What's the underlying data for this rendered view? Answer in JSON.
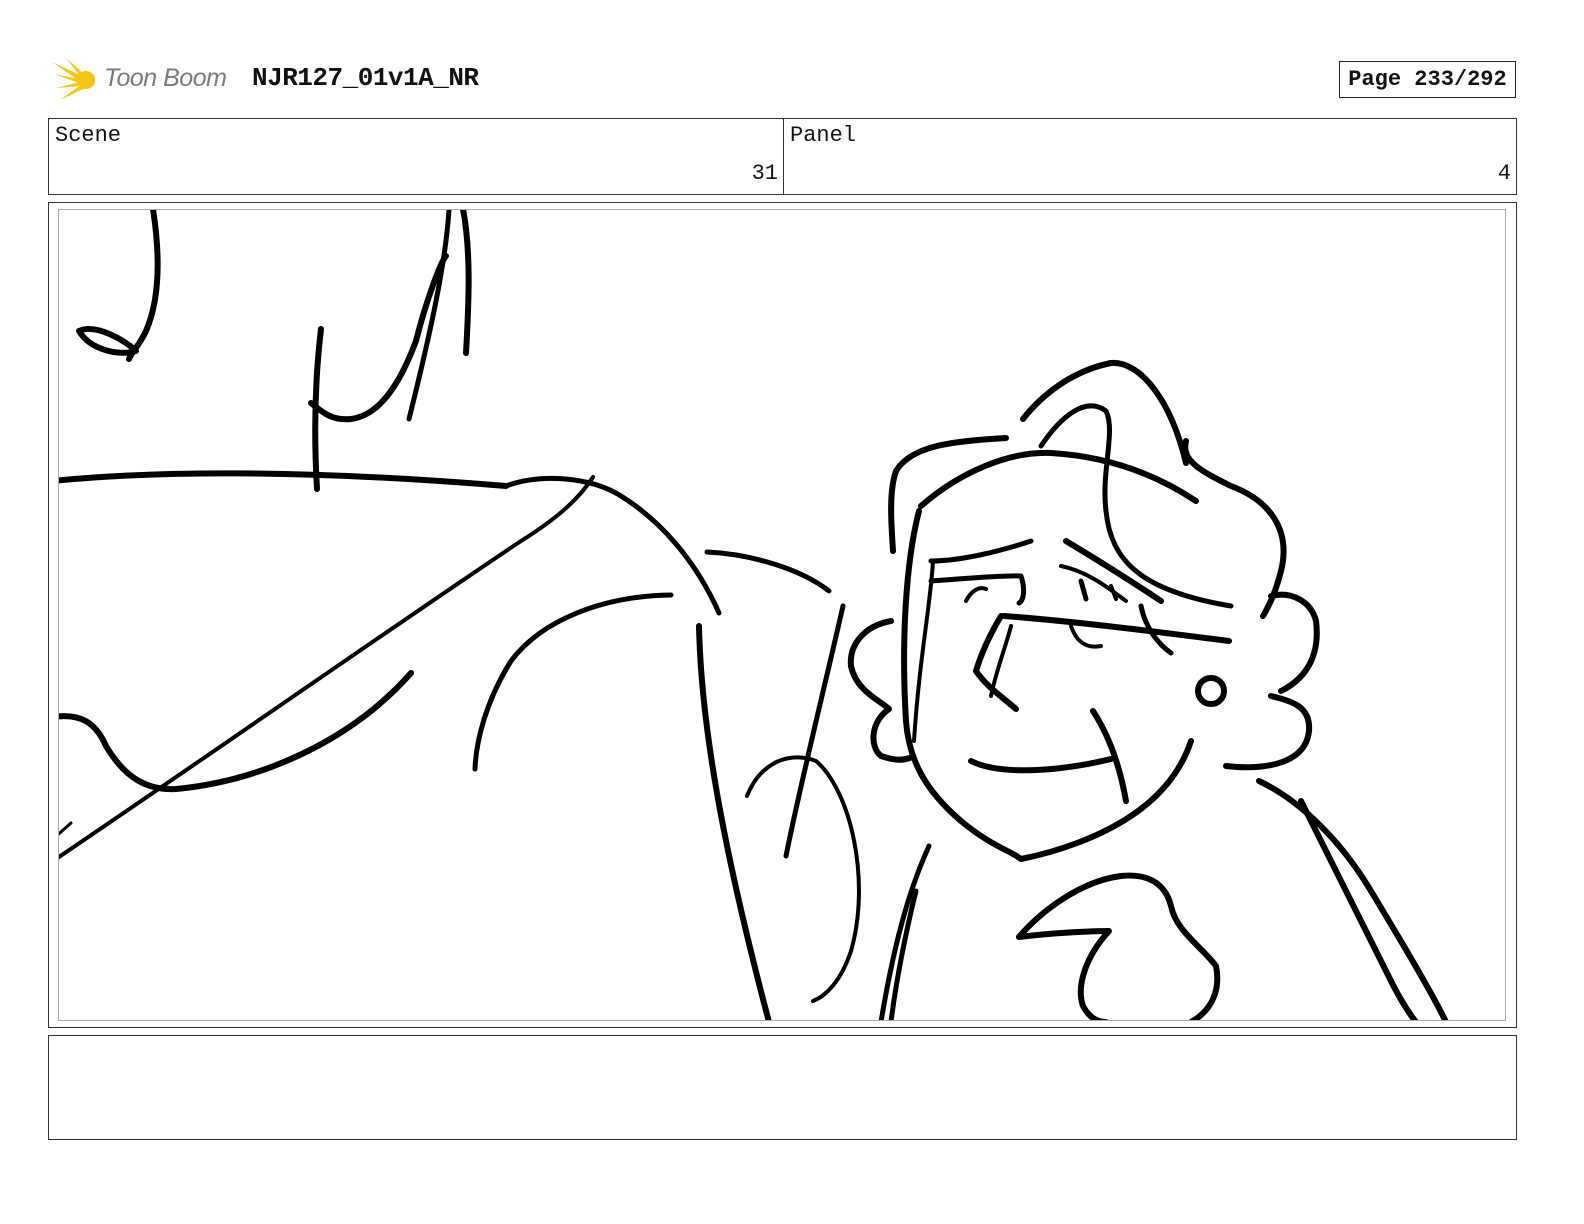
{
  "header": {
    "logo_text": "Toon Boom",
    "doc_title": "NJR127_01v1A_NR",
    "page_label": "Page 233/292"
  },
  "info": {
    "scene_label": "Scene",
    "scene_value": "31",
    "panel_label": "Panel",
    "panel_value": "4"
  },
  "notes": {
    "text": ""
  },
  "colors": {
    "logo_accent": "#f5c518",
    "ink": "#000000"
  }
}
